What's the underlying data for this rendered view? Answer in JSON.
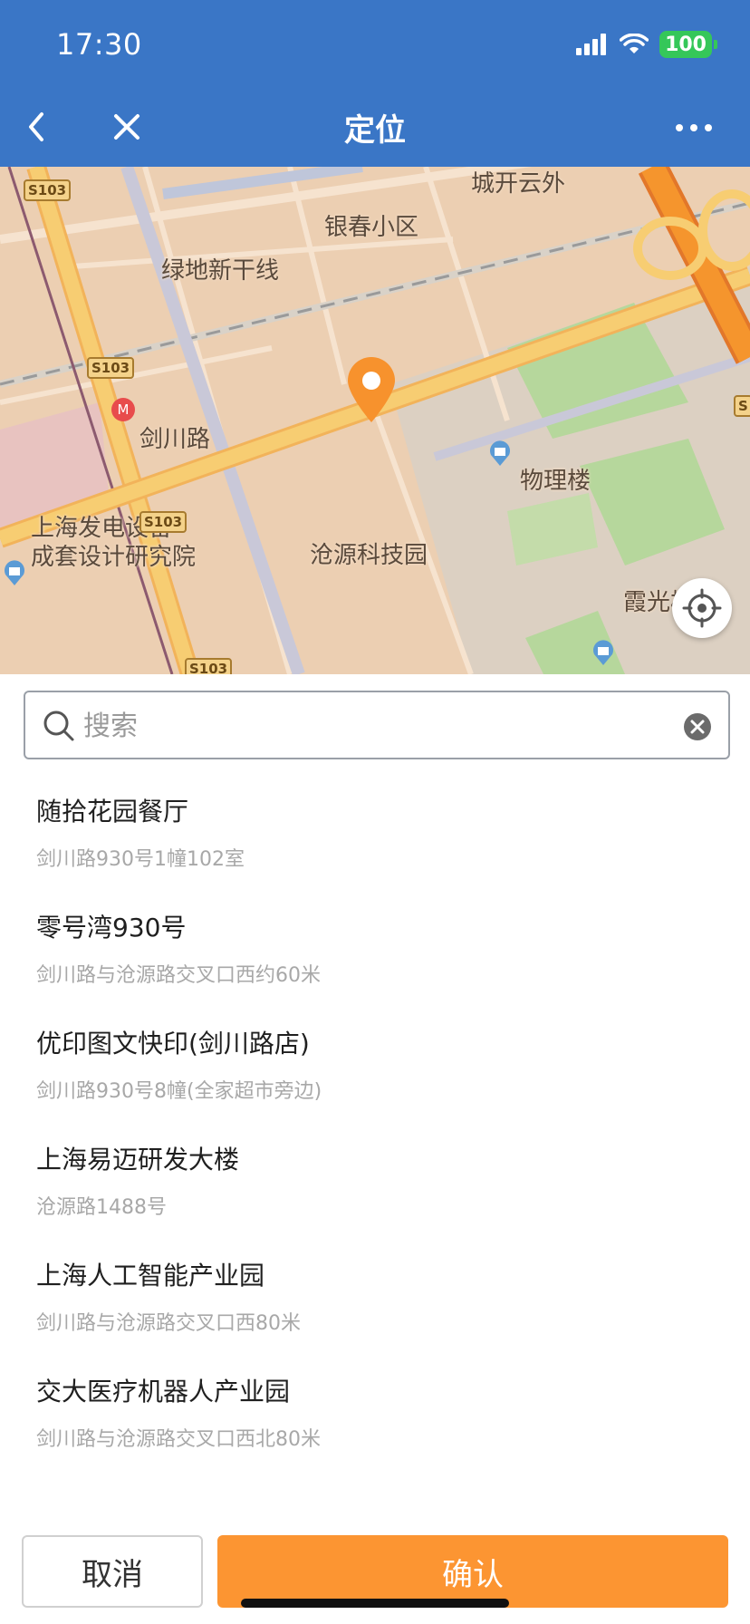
{
  "status_bar": {
    "time": "17:30",
    "battery": "100"
  },
  "nav": {
    "title": "定位"
  },
  "map": {
    "labels": {
      "chengkai": "城开云外",
      "yinchun": "银春小区",
      "lvdi": "绿地新干线",
      "jianchuan": "剑川路",
      "wuli": "物理楼",
      "shanghai_fadian_1": "上海发电设备",
      "shanghai_fadian_2": "成套设计研究院",
      "cangyuan": "沧源科技园",
      "xiaguang": "霞光楼"
    },
    "road_badges": [
      "S103",
      "S103",
      "S103",
      "S103"
    ],
    "road_badge_edge": "S",
    "colors": {
      "land": "#eccfb2",
      "campus": "#dcd0c2",
      "green": "#a8d18f",
      "road": "#f6c164",
      "expressway": "#f5952d",
      "pin": "#f7922d"
    }
  },
  "search": {
    "placeholder": "搜索",
    "value": ""
  },
  "results": [
    {
      "name": "随拾花园餐厅",
      "address": "剑川路930号1幢102室"
    },
    {
      "name": "零号湾930号",
      "address": "剑川路与沧源路交叉口西约60米"
    },
    {
      "name": "优印图文快印(剑川路店)",
      "address": "剑川路930号8幢(全家超市旁边)"
    },
    {
      "name": "上海易迈研发大楼",
      "address": "沧源路1488号"
    },
    {
      "name": "上海人工智能产业园",
      "address": "剑川路与沧源路交叉口西80米"
    },
    {
      "name": "交大医疗机器人产业园",
      "address": "剑川路与沧源路交叉口西北80米"
    }
  ],
  "buttons": {
    "cancel": "取消",
    "confirm": "确认"
  }
}
